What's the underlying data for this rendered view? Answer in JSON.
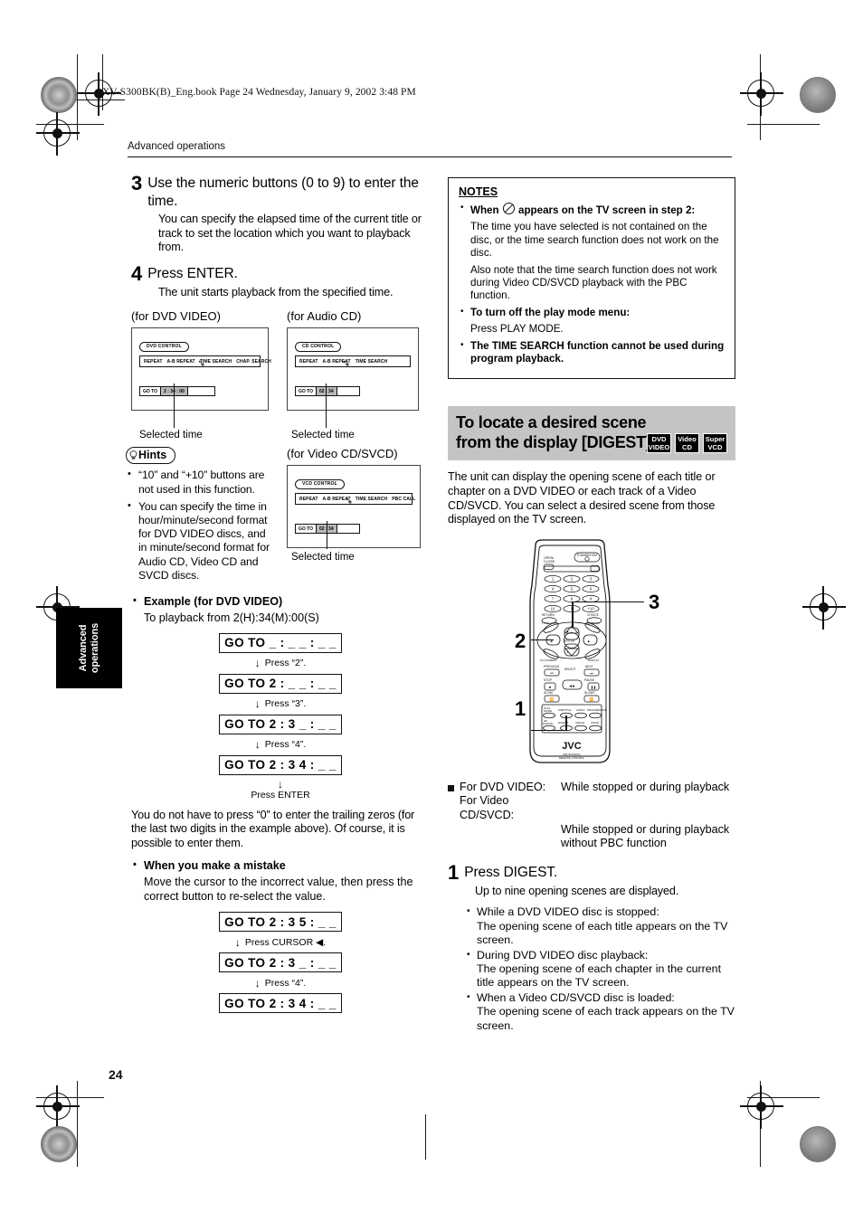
{
  "document": {
    "file_header": "XV-S300BK(B)_Eng.book  Page 24  Wednesday, January 9, 2002  3:48 PM",
    "running_head": "Advanced operations",
    "side_tab": "Advanced operations",
    "page_number": "24"
  },
  "left_column": {
    "step3": {
      "num": "3",
      "title": "Use the numeric buttons (0 to 9) to enter the time.",
      "body": "You can specify the elapsed time of the current title or track to set the location which you want to playback from."
    },
    "step4": {
      "num": "4",
      "title": "Press ENTER.",
      "body": "The unit starts playback from the specified time."
    },
    "panels": {
      "dvd": {
        "caption": "(for DVD VIDEO)",
        "control_label": "DVD CONTROL",
        "menu_items": [
          "REPEAT",
          "A-B REPEAT",
          "TIME SEARCH",
          "CHAP. SEARCH"
        ],
        "goto_label": "GO TO",
        "goto_value": "2 : 34 : 00",
        "leader_caption": "Selected time"
      },
      "cd": {
        "caption": "(for Audio CD)",
        "control_label": "CD CONTROL",
        "menu_items": [
          "REPEAT",
          "A-B REPEAT",
          "TIME SEARCH"
        ],
        "goto_label": "GO TO",
        "goto_value": "02 : 34",
        "leader_caption": "Selected time"
      },
      "vcd": {
        "caption": "(for Video CD/SVCD)",
        "control_label": "VCD CONTROL",
        "menu_items": [
          "REPEAT",
          "A-B REPEAT",
          "TIME SEARCH",
          "PBC CALL"
        ],
        "goto_label": "GO TO",
        "goto_value": "02 : 34",
        "leader_caption": "Selected time"
      }
    },
    "hints": {
      "badge": "Hints",
      "items": [
        "“10” and “+10” buttons are not used in this function.",
        "You can specify the time in hour/minute/second format for DVD VIDEO discs, and in minute/second format for Audio CD, Video CD and SVCD discs."
      ]
    },
    "example": {
      "heading": "Example (for DVD VIDEO)",
      "subheading": "To playback from 2(H):34(M):00(S)",
      "sequence": [
        {
          "display": "GO TO _ : _ _ : _ _",
          "action": "Press “2”."
        },
        {
          "display": "GO TO 2 : _ _ : _ _",
          "action": "Press “3”."
        },
        {
          "display": "GO TO 2 : 3 _ : _ _",
          "action": "Press “4”."
        },
        {
          "display": "GO TO 2 : 3 4 : _ _",
          "action": "Press ENTER"
        }
      ]
    },
    "trailing_note": "You do not have to press “0” to enter the trailing zeros (for the last two digits in the example above). Of course, it is possible to enter them.",
    "mistake": {
      "heading": "When you make a mistake",
      "body": "Move the cursor to the incorrect value, then press the correct button to re-select the value.",
      "sequence": [
        {
          "display": "GO TO 2 : 3 5 : _ _",
          "action": "Press CURSOR ◀."
        },
        {
          "display": "GO TO 2 : 3 _ : _ _",
          "action": "Press “4”."
        },
        {
          "display": "GO TO 2 : 3 4 : _ _",
          "action": ""
        }
      ]
    }
  },
  "right_column": {
    "notes": {
      "title": "NOTES",
      "items": [
        {
          "bold_lead": "When",
          "bold_tail": "appears on the TV screen in step 2:",
          "has_icon": true,
          "paragraphs": [
            "The time you have selected is not contained on the disc, or the time search function does not work on the disc.",
            "Also note that the time search function does not work during Video CD/SVCD playback with the PBC function."
          ]
        },
        {
          "bold_lead": "To turn off the play mode menu:",
          "paragraphs": [
            "Press PLAY MODE."
          ]
        },
        {
          "bold_lead": "The TIME SEARCH function cannot be used during program playback.",
          "paragraphs": []
        }
      ]
    },
    "section": {
      "title": "To locate a desired scene from the display [DIGEST]",
      "badges": [
        {
          "line1": "DVD",
          "line2": "VIDEO"
        },
        {
          "line1": "Video",
          "line2": "CD"
        },
        {
          "line1": "Super",
          "line2": "VCD"
        }
      ],
      "intro": "The unit can display the opening scene of each title or chapter on a DVD VIDEO or each track of a Video CD/SVCD.  You can select a desired scene from those displayed on the TV screen."
    },
    "remote": {
      "brand": "JVC",
      "sub_brand": "RM-SXVS01A REMOTE CONTROL",
      "callouts": [
        "1",
        "2",
        "3"
      ],
      "top_labels": {
        "left": "OPEN/ CLOSE",
        "right": "STANDBY/ON"
      },
      "numeric_keys": [
        "1",
        "2",
        "3",
        "4",
        "5",
        "6",
        "7",
        "8",
        "9",
        "10",
        "0",
        "+10"
      ],
      "mid_labels": {
        "left": "RETURN",
        "right": "CHOICE"
      },
      "nav_labels": {
        "top": "TITLE",
        "center": "ENTER",
        "bottom": "ON SCREEN"
      },
      "transport_labels": {
        "prev": "PREVIOUS",
        "next": "NEXT",
        "stop": "STOP",
        "select": "SELECT",
        "pause": "PAUSE",
        "rew": "SLOW-",
        "ff": "SLOW+"
      },
      "bottom_labels": [
        "PLAY MODE",
        "SUBTITLE",
        "AUDIO",
        "PROGRESSIVE",
        "3D PHONIC",
        "DIGEST",
        "ANGLE",
        "ZOOM"
      ]
    },
    "availability": {
      "rows": [
        {
          "term": "For DVD VIDEO:",
          "desc": "While stopped or during playback"
        },
        {
          "term": "For Video CD/SVCD:",
          "desc": ""
        },
        {
          "term": "",
          "desc": "While stopped or during playback without PBC function"
        }
      ]
    },
    "step1": {
      "num": "1",
      "title": "Press DIGEST.",
      "body": "Up to nine opening scenes are displayed.",
      "bullets": [
        "While a DVD VIDEO disc is stopped:\nThe opening scene of each title appears on the TV screen.",
        "During DVD VIDEO disc playback:\nThe opening scene of each chapter in the current title appears on the TV screen.",
        "When a Video CD/SVCD disc is loaded:\nThe opening scene of each track appears on the TV screen."
      ]
    }
  },
  "colors": {
    "section_header_bg": "#c4c4c4",
    "badge_bg": "#000000",
    "highlight_grey": "#b9b9b9"
  }
}
